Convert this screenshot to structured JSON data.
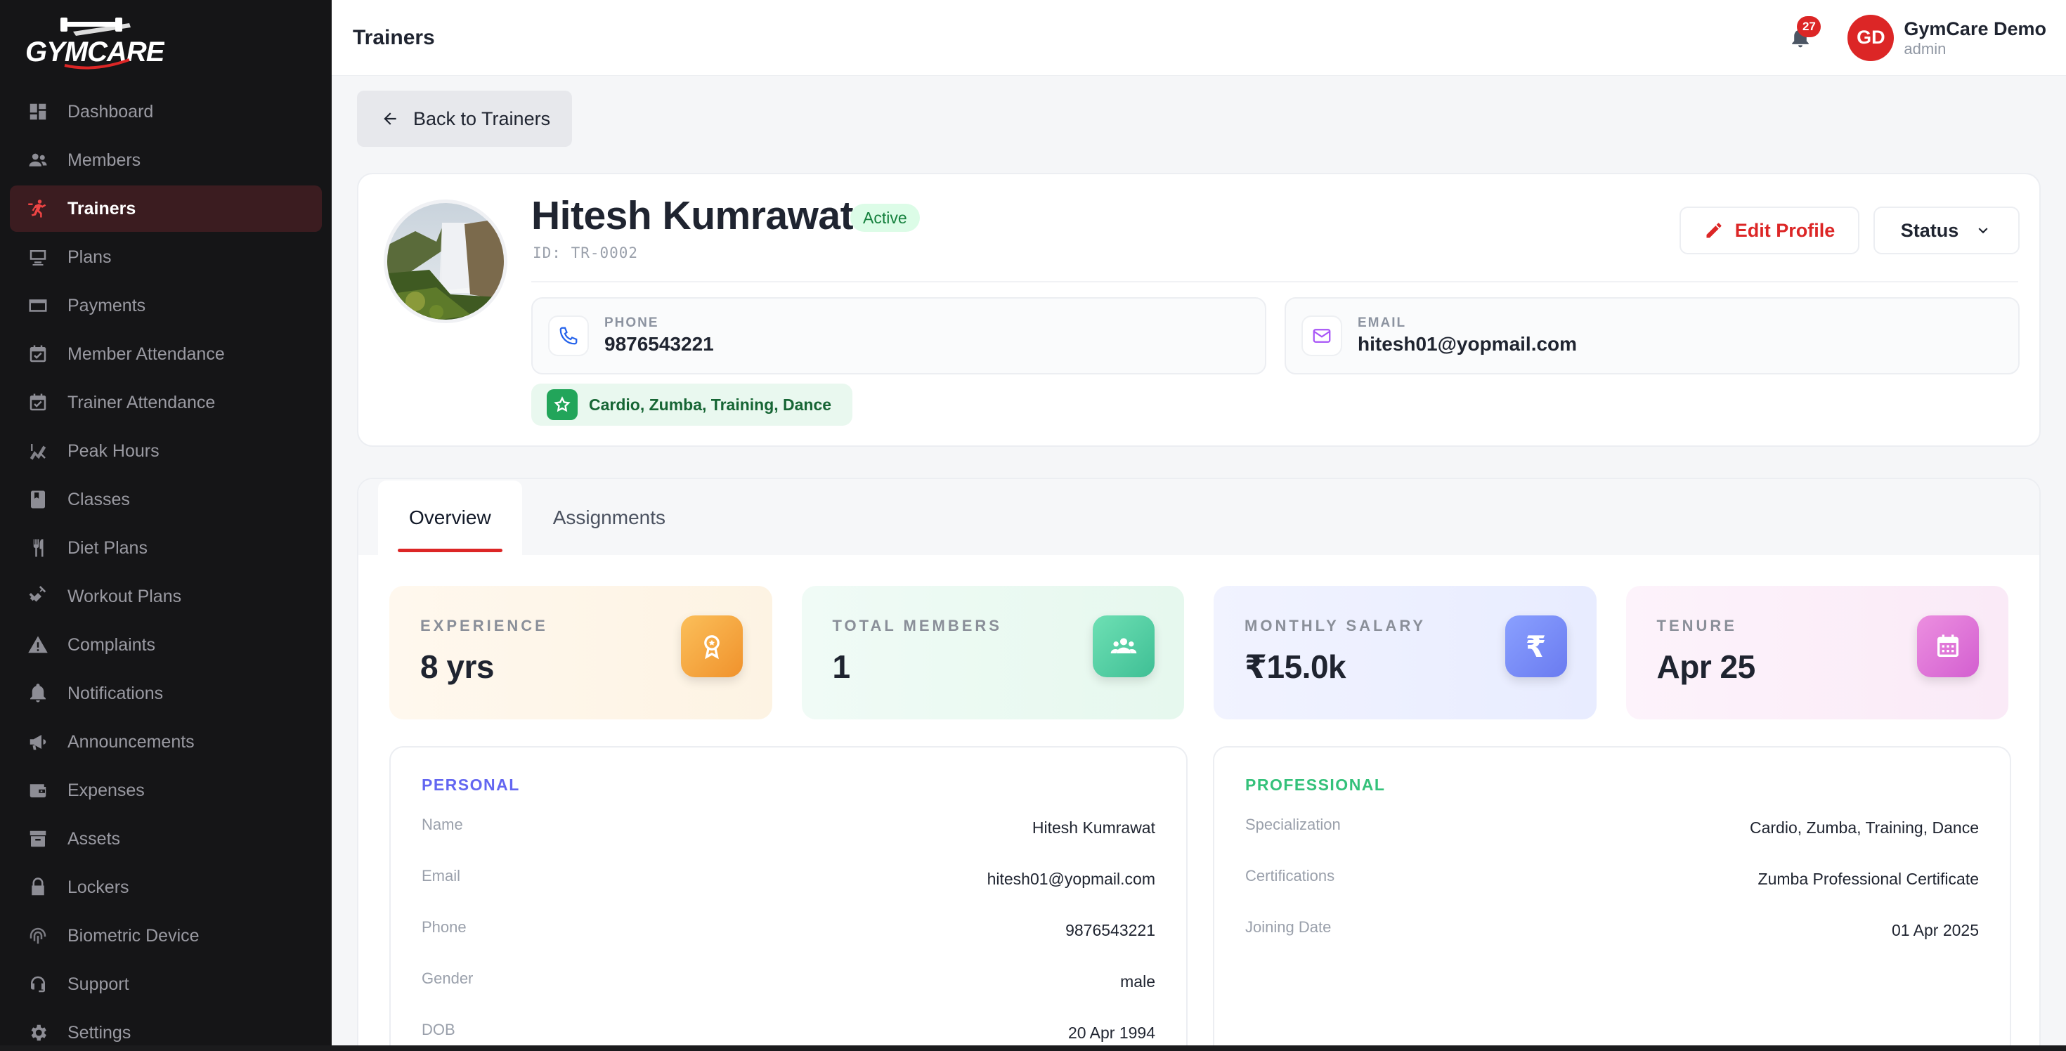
{
  "app": {
    "brand": "GYMCARE"
  },
  "sidebar": {
    "items": [
      {
        "label": "Dashboard",
        "icon": "dashboard-icon",
        "active": false
      },
      {
        "label": "Members",
        "icon": "members-icon",
        "active": false
      },
      {
        "label": "Trainers",
        "icon": "trainer-icon",
        "active": true
      },
      {
        "label": "Plans",
        "icon": "plans-icon",
        "active": false
      },
      {
        "label": "Payments",
        "icon": "payments-icon",
        "active": false
      },
      {
        "label": "Member Attendance",
        "icon": "calendar-check-icon",
        "active": false
      },
      {
        "label": "Trainer Attendance",
        "icon": "calendar-check-icon",
        "active": false
      },
      {
        "label": "Peak Hours",
        "icon": "chart-icon",
        "active": false
      },
      {
        "label": "Classes",
        "icon": "book-icon",
        "active": false
      },
      {
        "label": "Diet Plans",
        "icon": "utensils-icon",
        "active": false
      },
      {
        "label": "Workout Plans",
        "icon": "dumbbell-icon",
        "active": false
      },
      {
        "label": "Complaints",
        "icon": "warning-icon",
        "active": false
      },
      {
        "label": "Notifications",
        "icon": "bell-icon",
        "active": false
      },
      {
        "label": "Announcements",
        "icon": "megaphone-icon",
        "active": false
      },
      {
        "label": "Expenses",
        "icon": "wallet-icon",
        "active": false
      },
      {
        "label": "Assets",
        "icon": "archive-icon",
        "active": false
      },
      {
        "label": "Lockers",
        "icon": "lock-icon",
        "active": false
      },
      {
        "label": "Biometric Device",
        "icon": "fingerprint-icon",
        "active": false
      },
      {
        "label": "Support",
        "icon": "support-icon",
        "active": false
      },
      {
        "label": "Settings",
        "icon": "gear-icon",
        "active": false
      }
    ]
  },
  "header": {
    "title": "Trainers",
    "notification_count": "27",
    "user": {
      "initials": "GD",
      "name": "GymCare Demo",
      "role": "admin"
    }
  },
  "back_button": {
    "label": "Back to Trainers"
  },
  "profile": {
    "name": "Hitesh Kumrawat",
    "status": "Active",
    "id": "ID: TR-0002",
    "edit_label": "Edit Profile",
    "status_dropdown_label": "Status",
    "phone_label": "PHONE",
    "phone": "9876543221",
    "email_label": "EMAIL",
    "email": "hitesh01@yopmail.com",
    "specialization": "Cardio, Zumba, Training, Dance"
  },
  "tabs": [
    {
      "label": "Overview",
      "active": true
    },
    {
      "label": "Assignments",
      "active": false
    }
  ],
  "stats": {
    "experience": {
      "label": "EXPERIENCE",
      "value": "8 yrs"
    },
    "members": {
      "label": "TOTAL MEMBERS",
      "value": "1"
    },
    "salary": {
      "label": "MONTHLY SALARY",
      "value": "₹15.0k",
      "icon_glyph": "₹"
    },
    "tenure": {
      "label": "TENURE",
      "value": "Apr 25"
    }
  },
  "personal": {
    "heading": "PERSONAL",
    "rows": [
      {
        "k": "Name",
        "v": "Hitesh Kumrawat"
      },
      {
        "k": "Email",
        "v": "hitesh01@yopmail.com"
      },
      {
        "k": "Phone",
        "v": "9876543221"
      },
      {
        "k": "Gender",
        "v": "male"
      },
      {
        "k": "DOB",
        "v": "20 Apr 1994"
      }
    ]
  },
  "professional": {
    "heading": "PROFESSIONAL",
    "rows": [
      {
        "k": "Specialization",
        "v": "Cardio, Zumba, Training, Dance"
      },
      {
        "k": "Certifications",
        "v": "Zumba Professional Certificate"
      },
      {
        "k": "Joining Date",
        "v": "01 Apr 2025"
      }
    ]
  },
  "colors": {
    "accent": "#dc2626",
    "sidebar_bg": "#151517",
    "active_nav_bg": "#3b1c20"
  }
}
